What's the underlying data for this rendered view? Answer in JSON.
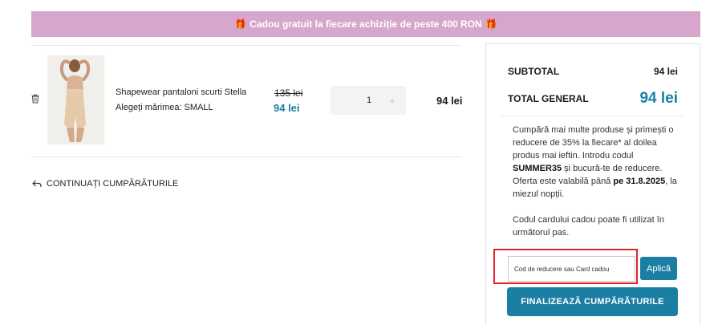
{
  "banner": {
    "icon_left": "🎁",
    "text": "Cadou gratuit la fiecare achiziție de peste 400 RON",
    "icon_right": "🎁"
  },
  "cart": {
    "item": {
      "name": "Shapewear pantaloni scurti Stella",
      "size": "Alegeți mărimea: SMALL",
      "old_price": "135 lei",
      "new_price": "94 lei",
      "quantity": "1",
      "plus_symbol": "+",
      "line_total": "94 lei"
    },
    "continue_label": "CONTINUAȚI CUMPĂRĂTURILE"
  },
  "summary": {
    "subtotal_label": "SUBTOTAL",
    "subtotal_value": "94 lei",
    "total_label": "TOTAL GENERAL",
    "total_value": "94 lei",
    "promo": {
      "part1": "Cumpără mai multe produse și primești o reducere de 35% la fiecare* al doilea produs mai ieftin. Introdu codul ",
      "code": "SUMMER35",
      "part2": " și bucură-te de reducere. Oferta este valabilă până ",
      "date": "pe 31.8.2025",
      "part3": ", la miezul nopții."
    },
    "giftcard_note": "Codul cardului cadou poate fi utilizat în următorul pas.",
    "coupon_placeholder": "Cod de reducere sau Card cadou",
    "apply_label": "Aplică",
    "checkout_label": "FINALIZEAZĂ CUMPĂRĂTURILE"
  },
  "colors": {
    "banner_bg": "#d7a6cd",
    "accent": "#1b7fa4",
    "highlight_border": "#e0262b"
  },
  "icons": {
    "delete": "trash-icon",
    "continue": "return-arrow-icon",
    "gift": "gift-icon"
  }
}
